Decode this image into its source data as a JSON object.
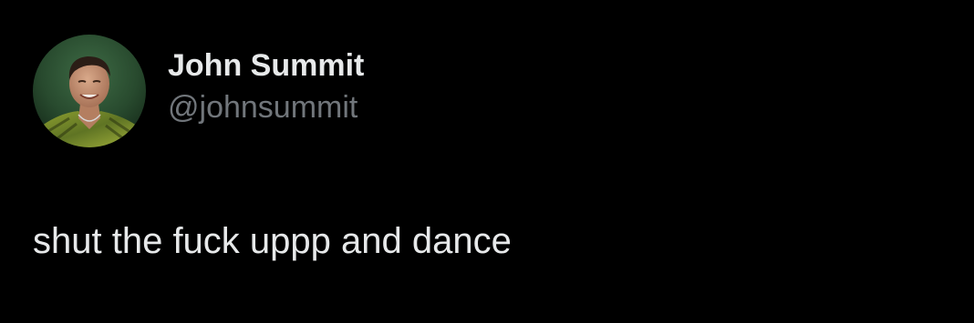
{
  "author": {
    "display_name": "John Summit",
    "handle": "@johnsummit"
  },
  "tweet": {
    "text": "shut the fuck uppp and dance"
  },
  "colors": {
    "background": "#000000",
    "primary_text": "#e7e9ea",
    "secondary_text": "#71767b"
  },
  "icons": {
    "avatar": "profile-photo-avatar"
  }
}
